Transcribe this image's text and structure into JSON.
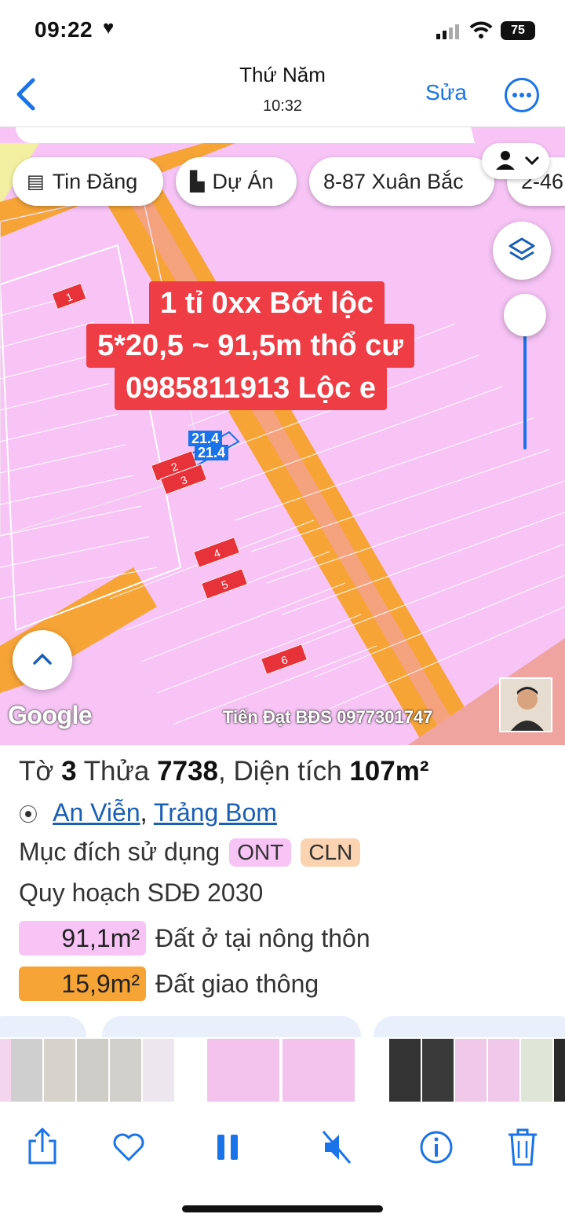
{
  "status_bar": {
    "time": "09:22",
    "battery": "75"
  },
  "nav": {
    "title": "Thứ Năm",
    "subtitle": "10:32",
    "edit": "Sửa"
  },
  "map": {
    "chips": [
      {
        "icon": "listing-icon",
        "label": "Tin Đăng"
      },
      {
        "icon": "building-icon",
        "label": "Dự Án"
      },
      {
        "label": "8-87 Xuân Bắc"
      },
      {
        "label": "2-46"
      }
    ],
    "banner_lines": [
      "1 tỉ 0xx Bớt lộc",
      "5*20,5 ~ 91,5m thổ cư",
      "0985811913 Lộc e"
    ],
    "plot_labels": [
      "1",
      "2",
      "3",
      "4",
      "5",
      "6"
    ],
    "dimension_labels": [
      "21.4",
      "21.4"
    ],
    "google_logo": "Google",
    "watermark": "Tiến Đạt BĐS 0977301747"
  },
  "parcel": {
    "to_label": "Tờ",
    "to_value": "3",
    "thua_label": "Thửa",
    "thua_value": "7738",
    "area_label": "Diện tích",
    "area_value": "107m²",
    "commune": "An Viễn",
    "district": "Trảng Bom",
    "purpose_label": "Mục đích sử dụng",
    "purpose_tags": [
      "ONT",
      "CLN"
    ],
    "plan_label": "Quy hoạch SDĐ 2030",
    "zones": [
      {
        "area": "91,1m²",
        "name": "Đất ở tại nông thôn",
        "color": "#f7c4f5"
      },
      {
        "area": "15,9m²",
        "name": "Đất giao thông",
        "color": "#f7a436"
      }
    ]
  },
  "colors": {
    "accent": "#1a73e8",
    "banner": "#ee3d44",
    "road": "#f7a436",
    "residential": "#f7c4f5",
    "ont_tag": "#f7c4f5",
    "cln_tag": "#fbd3b0"
  },
  "toolbar": [
    "share-icon",
    "heart-icon",
    "pause-icon",
    "mute-icon",
    "info-icon",
    "trash-icon"
  ]
}
